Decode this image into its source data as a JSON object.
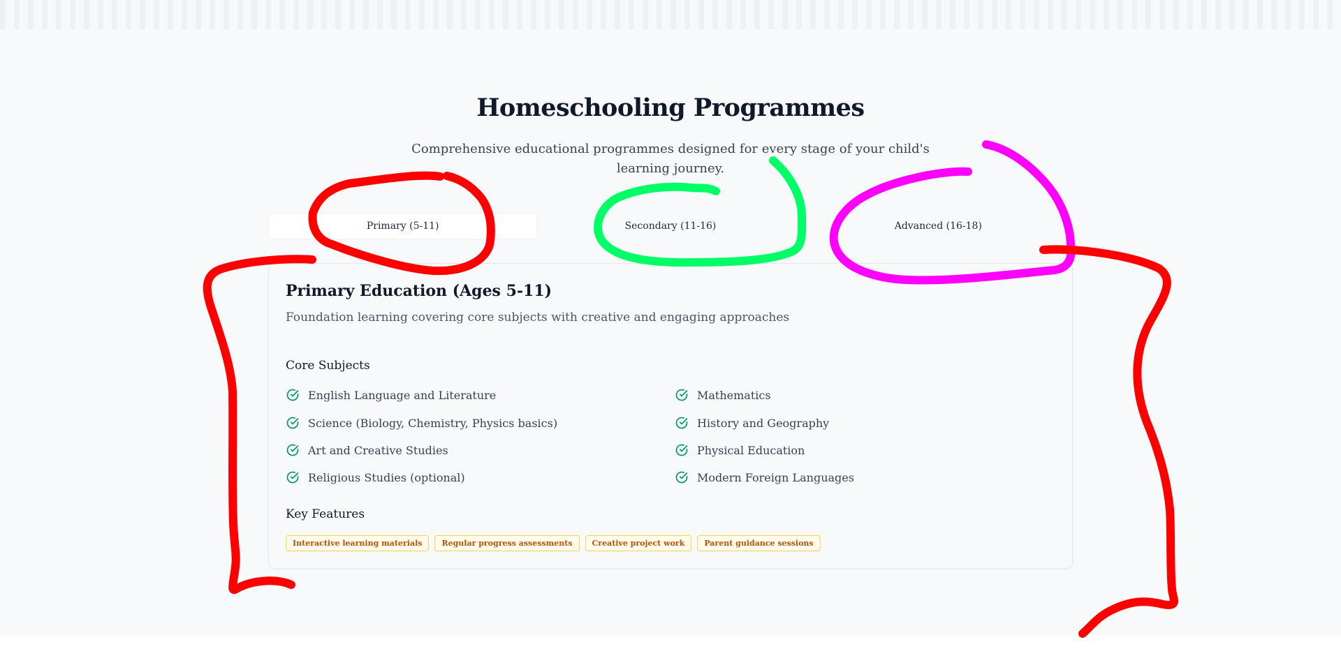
{
  "header": {
    "title": "Homeschooling Programmes",
    "subtitle": "Comprehensive educational programmes designed for every stage of your child's learning journey."
  },
  "tabs": [
    {
      "label": "Primary (5-11)",
      "active": true
    },
    {
      "label": "Secondary (11-16)",
      "active": false
    },
    {
      "label": "Advanced (16-18)",
      "active": false
    }
  ],
  "panel": {
    "title": "Primary Education (Ages 5-11)",
    "description": "Foundation learning covering core subjects with creative and engaging approaches",
    "core_heading": "Core Subjects",
    "subjects": [
      "English Language and Literature",
      "Mathematics",
      "Science (Biology, Chemistry, Physics basics)",
      "History and Geography",
      "Art and Creative Studies",
      "Physical Education",
      "Religious Studies (optional)",
      "Modern Foreign Languages"
    ],
    "features_heading": "Key Features",
    "features": [
      "Interactive learning materials",
      "Regular progress assessments",
      "Creative project work",
      "Parent guidance sessions"
    ]
  },
  "colors": {
    "check": "#059669",
    "feature_text": "#b45309",
    "annotation_red": "#ff0000",
    "annotation_green": "#00ff66",
    "annotation_magenta": "#ff00ff"
  },
  "icons": {
    "subject_bullet": "check-circle-icon"
  }
}
